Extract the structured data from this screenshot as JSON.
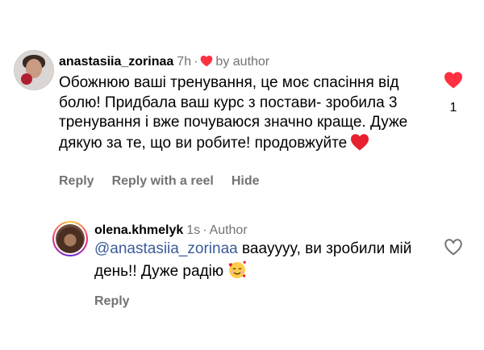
{
  "comments": [
    {
      "username": "anastasiia_zorinaa",
      "time": "7h",
      "separator": "·",
      "liked_by_author": "by author",
      "text": "Обожнюю ваші тренування, це моє спасіння від болю! Придбала ваш курс з постави- зробила 3 тренування і вже почуваюся значно краще. Дуже дякую за те, що ви робите! продовжуйте",
      "trailing_emoji": "red-heart",
      "like_state": "liked",
      "like_count": "1",
      "actions": [
        "Reply",
        "Reply with a reel",
        "Hide"
      ]
    },
    {
      "username": "olena.khmelyk",
      "time": "1s",
      "separator": "·",
      "author_tag": "Author",
      "mention": "@anastasiia_zorinaa",
      "text": " вааyyyy, ви зробили мій день!! Дуже радію",
      "trailing_emoji": "smiling-face-with-hearts",
      "like_state": "not-liked",
      "actions": [
        "Reply"
      ]
    }
  ],
  "colors": {
    "like_red": "#ff3040",
    "secondary_text": "#737373",
    "mention_blue": "#3b5b99"
  }
}
